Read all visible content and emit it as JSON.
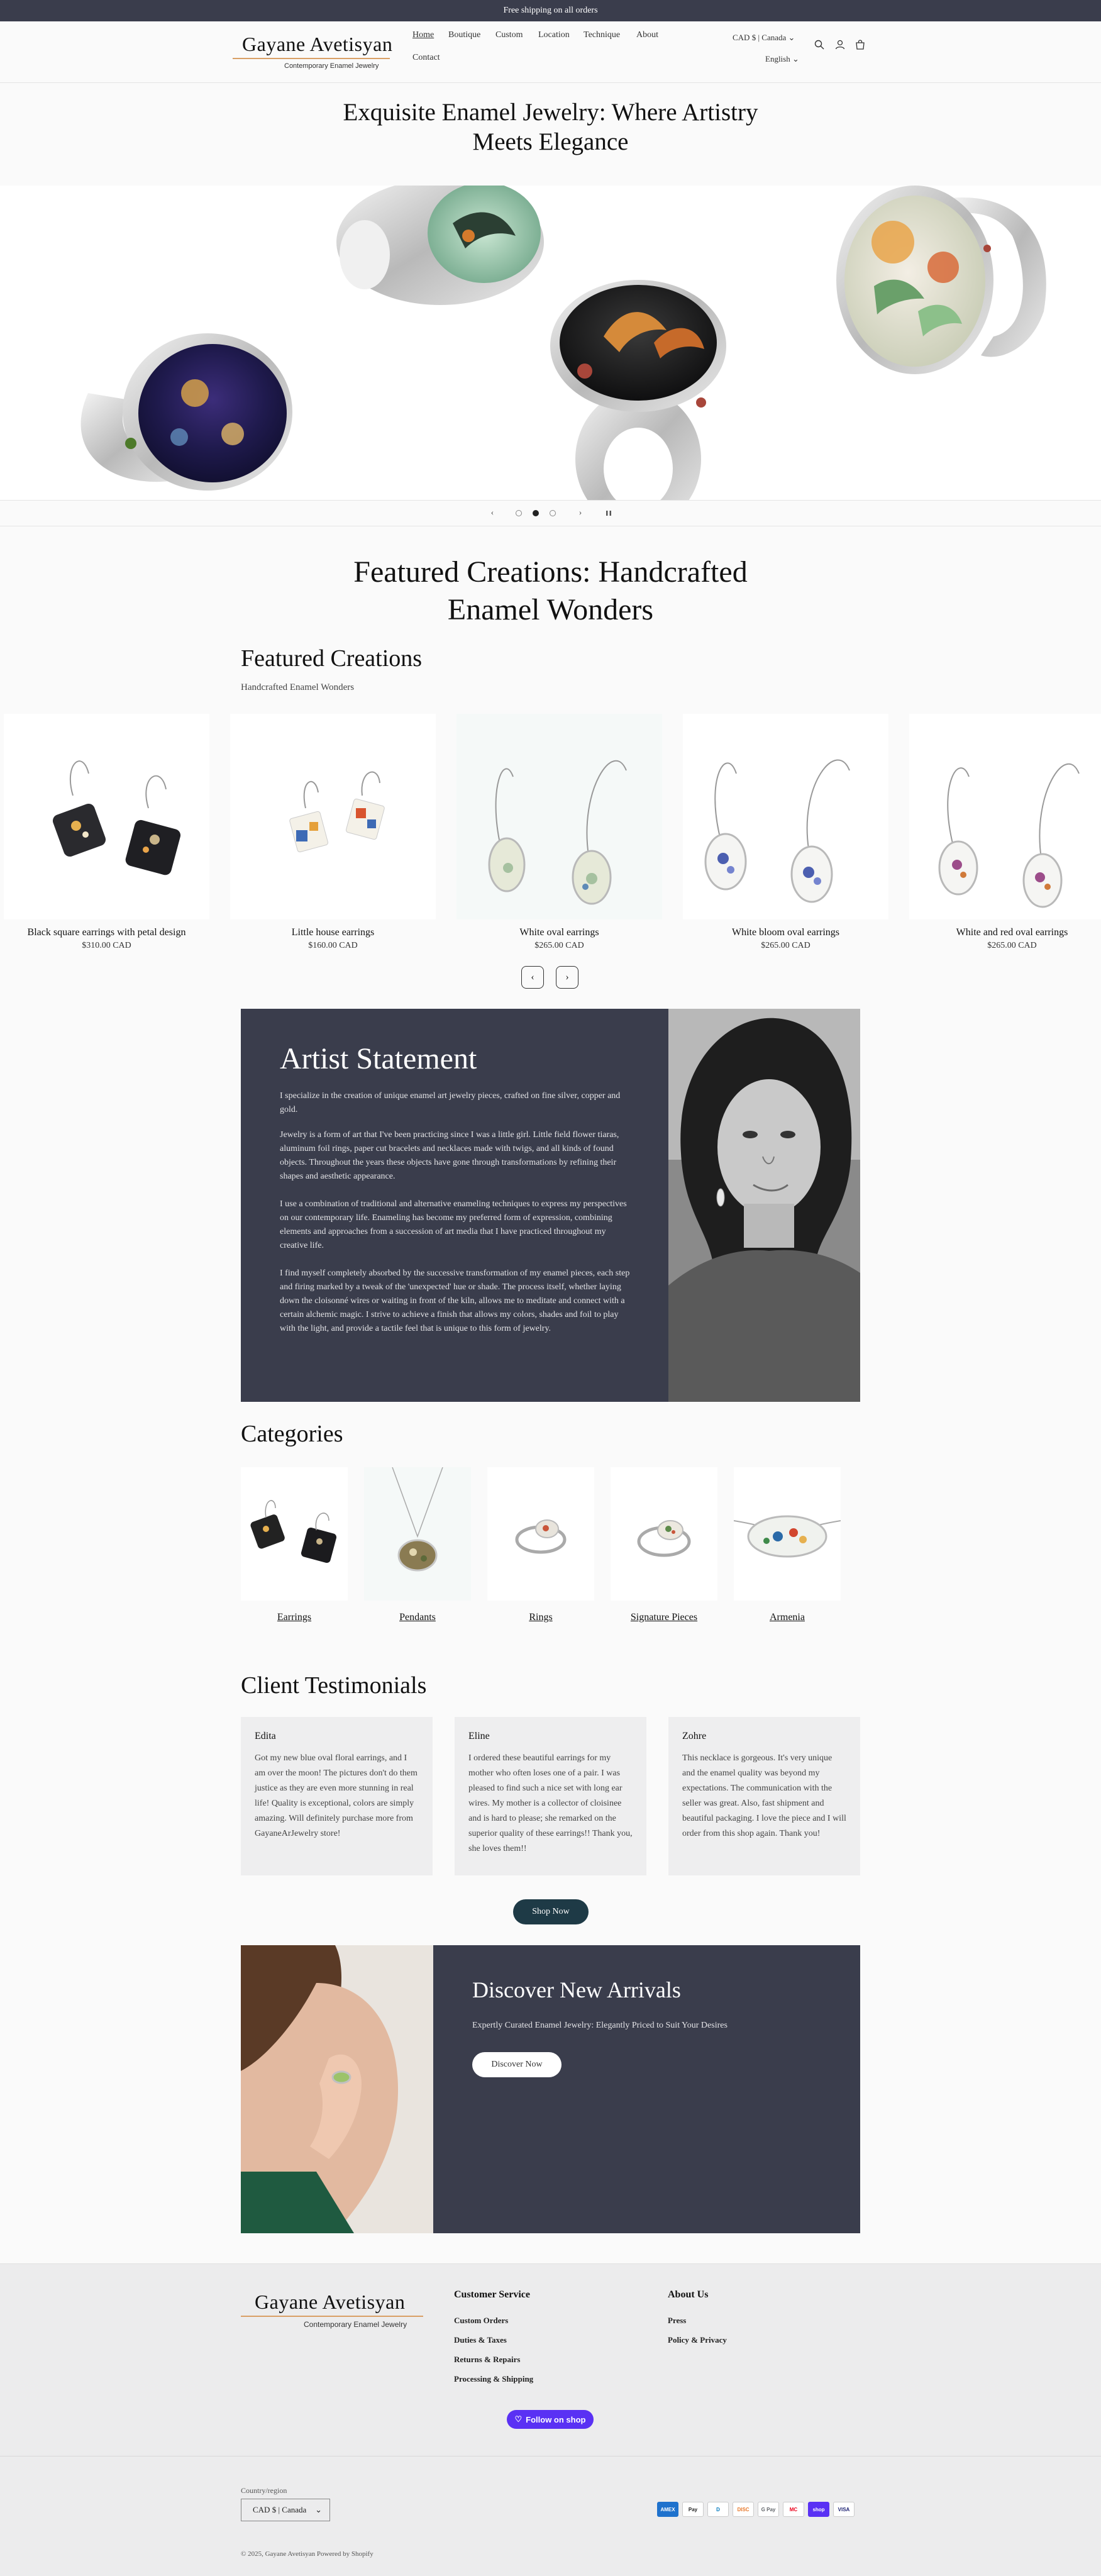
{
  "announcement": "Free shipping on all orders",
  "header": {
    "logo_name": "Gayane Avetisyan",
    "logo_tagline": "Contemporary Enamel Jewelry",
    "nav": [
      "Home",
      "Boutique",
      "Custom",
      "Location",
      "Technique",
      "About",
      "Contact"
    ],
    "currency": "CAD $ | Canada",
    "language": "English"
  },
  "hero": {
    "title_line1": "Exquisite Enamel Jewelry: Where Artistry",
    "title_line2": "Meets Elegance"
  },
  "featured": {
    "heading_line1": "Featured Creations: Handcrafted",
    "heading_line2": "Enamel Wonders",
    "title": "Featured Creations",
    "subtitle": "Handcrafted Enamel Wonders",
    "products": [
      {
        "name": "Black square earrings with petal design",
        "price": "$310.00 CAD"
      },
      {
        "name": "Little house earrings",
        "price": "$160.00 CAD"
      },
      {
        "name": "White oval earrings",
        "price": "$265.00 CAD"
      },
      {
        "name": "White bloom oval earrings",
        "price": "$265.00 CAD"
      },
      {
        "name": "White and red oval earrings",
        "price": "$265.00 CAD"
      }
    ]
  },
  "artist": {
    "title": "Artist Statement",
    "p1": "I specialize in the creation of unique enamel art jewelry pieces, crafted on fine silver, copper and gold.",
    "p2": "Jewelry is a form of art that I've been practicing since I was a little girl. Little field flower tiaras, aluminum foil rings, paper cut bracelets and necklaces made with twigs, and all kinds of found objects. Throughout the years these objects have gone through transformations by refining their shapes and aesthetic appearance.",
    "p3": "I use a combination of traditional and alternative enameling techniques to express my perspectives on our contemporary life. Enameling has become my preferred form of expression, combining elements and approaches from a succession of art media that I have practiced throughout my creative life.",
    "p4": "I find myself completely absorbed by the successive transformation of my enamel pieces, each step and firing marked by a tweak of the 'unexpected' hue or shade. The process itself, whether laying down the cloisonné wires or waiting in front of the kiln, allows me to meditate and connect with a certain alchemic magic. I strive to achieve a finish that allows my colors, shades and foil to play with the light, and provide a tactile feel that is unique to this form of jewelry."
  },
  "categories": {
    "title": "Categories",
    "items": [
      "Earrings",
      "Pendants",
      "Rings",
      "Signature Pieces",
      "Armenia"
    ]
  },
  "testimonials": {
    "title": "Client Testimonials",
    "items": [
      {
        "name": "Edita",
        "text": "Got my new blue oval floral earrings, and I am over the moon! The pictures don't do them justice as they are even more stunning in real life! Quality is exceptional, colors are simply amazing. Will definitely purchase more from GayaneArJewelry store!"
      },
      {
        "name": "Eline",
        "text": "I ordered these beautiful earrings for my mother who often loses one of a pair. I was pleased to find such a nice set with long ear wires. My mother is a collector of cloisinee and is hard to please; she remarked on the superior quality of these earrings!! Thank you, she loves them!!"
      },
      {
        "name": "Zohre",
        "text": "This necklace is gorgeous. It's very unique and the enamel quality was beyond my expectations. The communication with the seller was great. Also, fast shipment and beautiful packaging. I love the piece and I will order from this shop again. Thank you!"
      }
    ],
    "button": "Shop Now"
  },
  "discover": {
    "title": "Discover New Arrivals",
    "subtitle": "Expertly Curated Enamel Jewelry: Elegantly Priced to Suit Your Desires",
    "button": "Discover Now"
  },
  "footer": {
    "customer_service_title": "Customer Service",
    "customer_service_links": [
      "Custom Orders",
      "Duties & Taxes",
      "Returns & Repairs",
      "Processing & Shipping"
    ],
    "about_title": "About Us",
    "about_links": [
      "Press",
      "Policy & Privacy"
    ],
    "follow_label": "Follow on shop",
    "country_label": "Country/region",
    "country_value": "CAD $ | Canada",
    "payments": [
      "AMEX",
      "Pay",
      "D",
      "DISC",
      "G Pay",
      "MC",
      "shop",
      "VISA"
    ],
    "copyright": "© 2025, Gayane Avetisyan Powered by Shopify"
  },
  "colors": {
    "announcement_bg": "#3a3d4c",
    "panel_bg": "#3a3d4c",
    "shop_button": "#1e3a46",
    "follow_button": "#5a31f4",
    "logo_line": "#d9a066"
  }
}
